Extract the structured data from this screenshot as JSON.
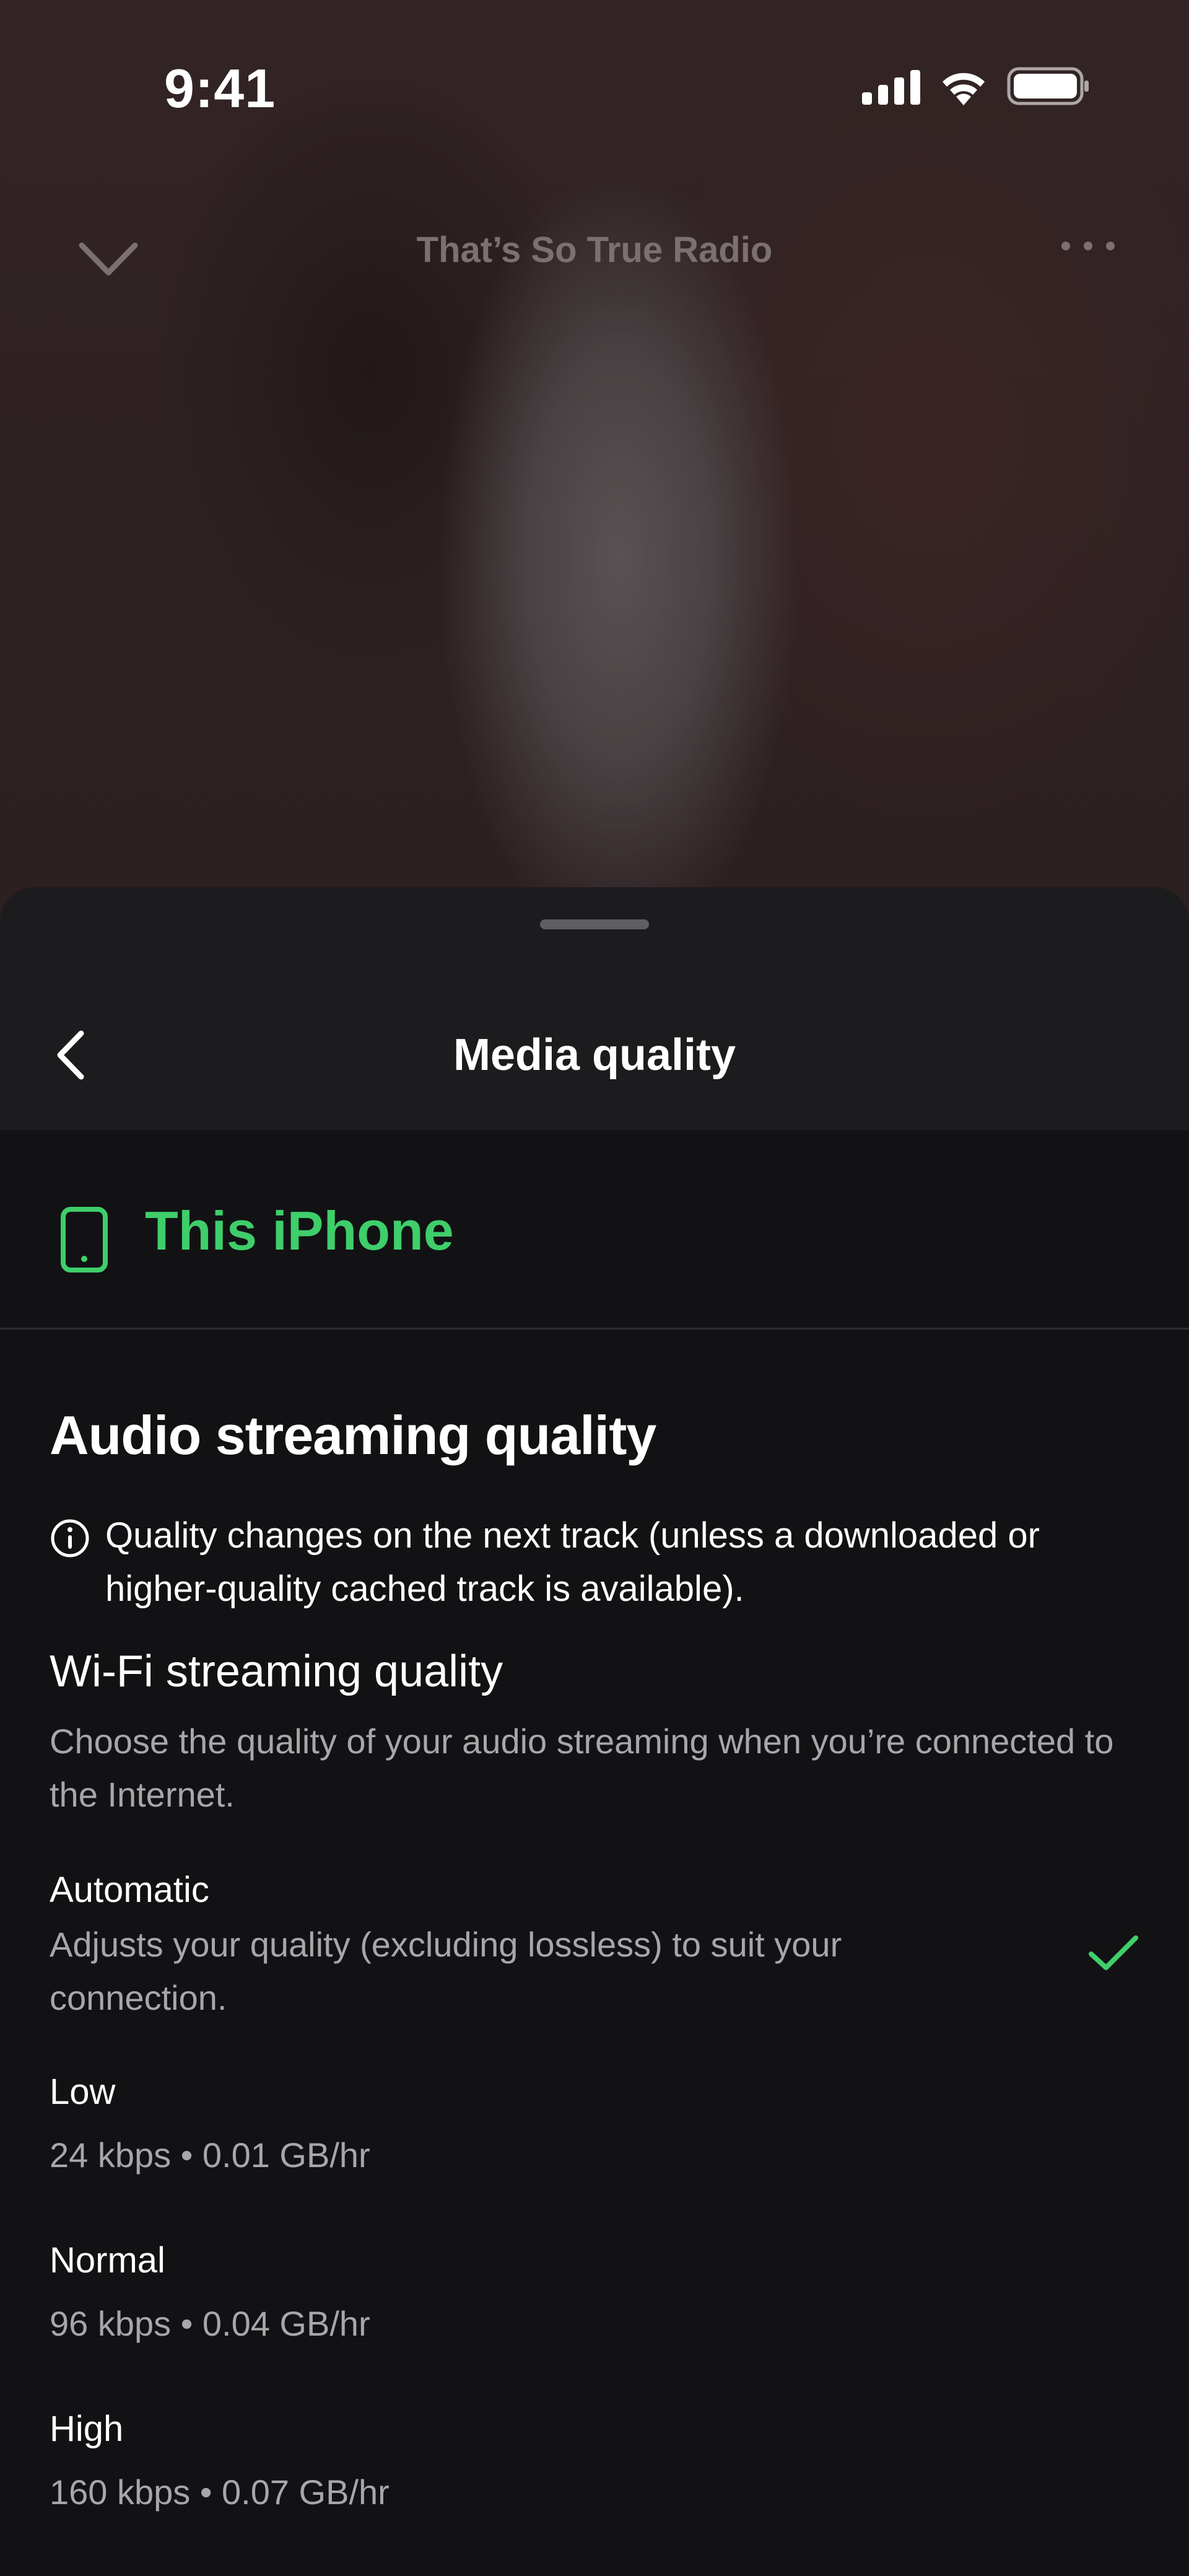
{
  "status_bar": {
    "time": "9:41"
  },
  "now_playing": {
    "title": "That’s So True Radio",
    "collapse_icon": "chevron-down-icon",
    "more_icon": "more-horizontal-icon"
  },
  "sheet": {
    "title": "Media quality",
    "back_icon": "chevron-left-icon"
  },
  "device": {
    "label": "This iPhone",
    "icon": "phone-icon",
    "color": "#3ece6a"
  },
  "audio_streaming": {
    "title": "Audio streaming quality",
    "info": "Quality changes on the next track (unless a downloaded or higher-quality cached track is available).",
    "wifi_heading": "Wi-Fi streaming quality",
    "wifi_description": "Choose the quality of your audio streaming when you’re connected to the Internet.",
    "options": [
      {
        "label": "Automatic",
        "description": "Adjusts your quality (excluding lossless) to suit your connection.",
        "selected": true
      },
      {
        "label": "Low",
        "description": "24 kbps • 0.01 GB/hr",
        "selected": false
      },
      {
        "label": "Normal",
        "description": "96 kbps • 0.04 GB/hr",
        "selected": false
      },
      {
        "label": "High",
        "description": "160 kbps • 0.07 GB/hr",
        "selected": false
      }
    ]
  },
  "colors": {
    "accent": "#3ece6a",
    "sheet_background": "#121214",
    "header_background": "#1c1c1e",
    "secondary_text": "#a7a7aa"
  }
}
